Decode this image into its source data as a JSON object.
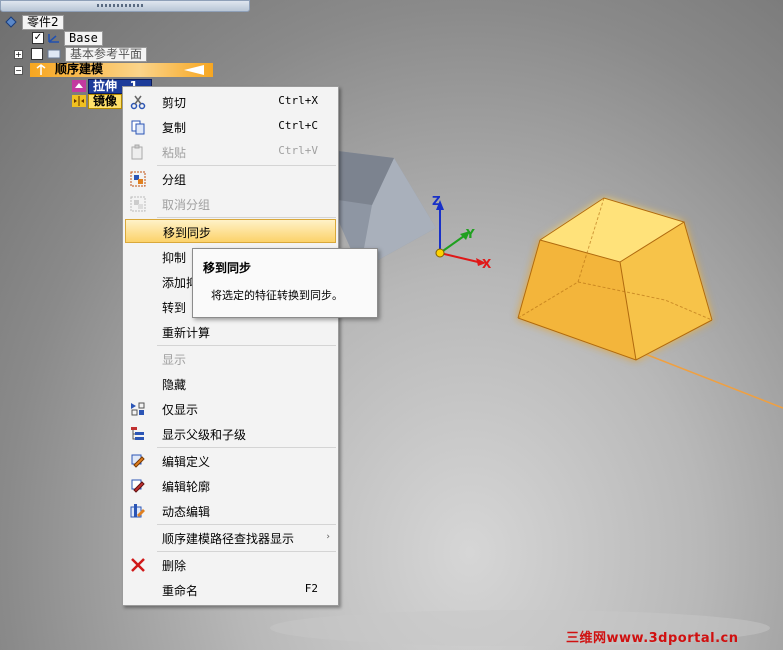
{
  "tree": {
    "root_label": "零件2",
    "base_label": "Base",
    "ref_planes_label": "基本参考平面",
    "ordered_label": "顺序建模",
    "extrude_label": "拉伸",
    "extrude_suffix": "1",
    "mirror_label": "镜像"
  },
  "menu": {
    "items": [
      {
        "label": "剪切",
        "shortcut": "Ctrl+X",
        "icon": "scissors-icon",
        "enabled": true
      },
      {
        "label": "复制",
        "shortcut": "Ctrl+C",
        "icon": "copy-icon",
        "enabled": true
      },
      {
        "label": "粘贴",
        "shortcut": "Ctrl+V",
        "icon": "paste-icon",
        "enabled": false
      },
      {
        "label": "分组",
        "shortcut": "",
        "icon": "group-icon",
        "enabled": true
      },
      {
        "label": "取消分组",
        "shortcut": "",
        "icon": "ungroup-icon",
        "enabled": false
      },
      {
        "label": "移到同步",
        "shortcut": "",
        "icon": "",
        "enabled": true,
        "highlighted": true
      },
      {
        "label": "抑制",
        "shortcut": "",
        "icon": "",
        "enabled": true
      },
      {
        "label": "添加抑",
        "shortcut": "",
        "icon": "",
        "enabled": true
      },
      {
        "label": "转到",
        "shortcut": "",
        "icon": "",
        "enabled": true
      },
      {
        "label": "重新计算",
        "shortcut": "",
        "icon": "",
        "enabled": true
      },
      {
        "label": "显示",
        "shortcut": "",
        "icon": "",
        "enabled": false
      },
      {
        "label": "隐藏",
        "shortcut": "",
        "icon": "",
        "enabled": true
      },
      {
        "label": "仅显示",
        "shortcut": "",
        "icon": "show-only-icon",
        "enabled": true
      },
      {
        "label": "显示父级和子级",
        "shortcut": "",
        "icon": "parent-child-icon",
        "enabled": true
      },
      {
        "label": "编辑定义",
        "shortcut": "",
        "icon": "edit-definition-icon",
        "enabled": true
      },
      {
        "label": "编辑轮廓",
        "shortcut": "",
        "icon": "edit-profile-icon",
        "enabled": true
      },
      {
        "label": "动态编辑",
        "shortcut": "",
        "icon": "dynamic-edit-icon",
        "enabled": true
      },
      {
        "label": "顺序建模路径查找器显示",
        "shortcut": "",
        "icon": "",
        "enabled": true,
        "submenu": true
      },
      {
        "label": "删除",
        "shortcut": "",
        "icon": "delete-icon",
        "enabled": true
      },
      {
        "label": "重命名",
        "shortcut": "F2",
        "icon": "",
        "enabled": true
      }
    ],
    "submenu_arrow": "›"
  },
  "tooltip": {
    "title": "移到同步",
    "description": "将选定的特征转换到同步。"
  },
  "axes": {
    "x": "X",
    "y": "Y",
    "z": "Z"
  },
  "watermark": "三维网www.3dportal.cn",
  "colors": {
    "highlight": "#fcd26a",
    "selection": "#1d3c9a",
    "axis_x": "#e01818",
    "axis_y": "#1fa01f",
    "axis_z": "#1830c8"
  }
}
